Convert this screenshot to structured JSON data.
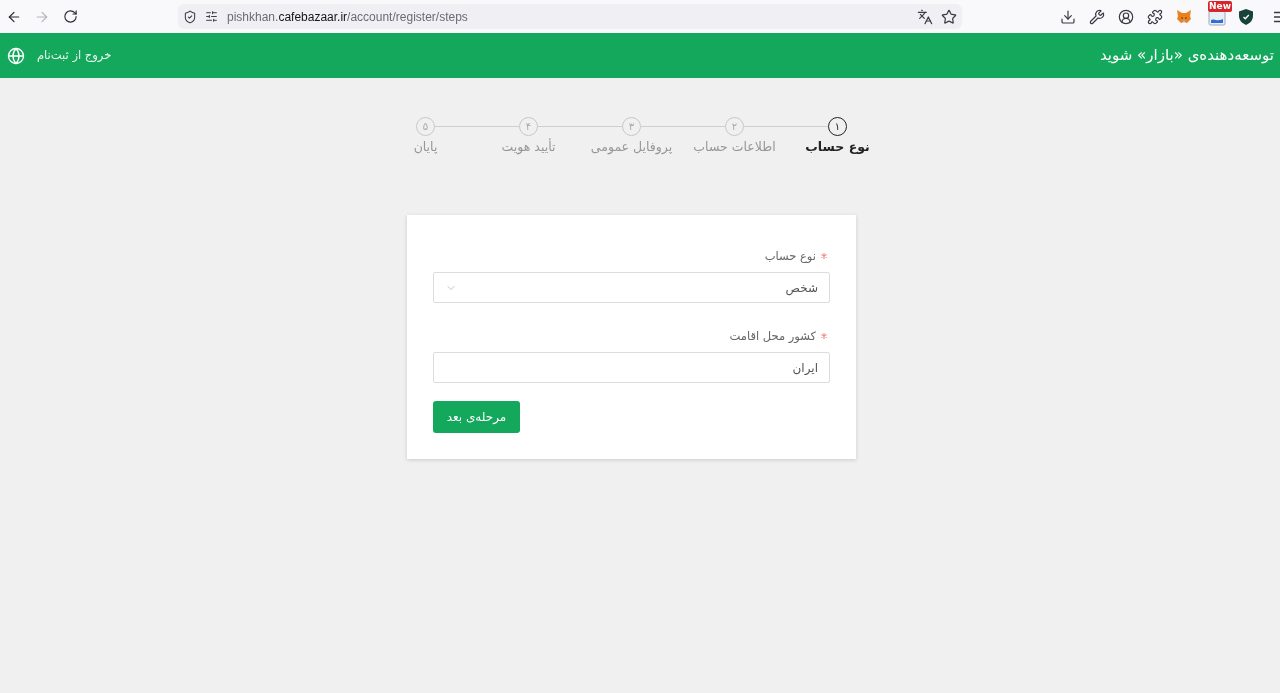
{
  "browser": {
    "back": {
      "disabled": false
    },
    "forward": {
      "disabled": true
    },
    "url": {
      "subdomain": "pishkhan.",
      "domain": "cafebazaar.ir",
      "path": "/account/register/steps"
    },
    "extension_badge": "New"
  },
  "header": {
    "title": "توسعه‌دهنده‌ی «بازار» شوید",
    "exit_link": "خروج از ثبت‌نام"
  },
  "steps": [
    {
      "number": "۱",
      "label": "نوع حساب",
      "selected": true
    },
    {
      "number": "۲",
      "label": "اطلاعات حساب",
      "selected": false
    },
    {
      "number": "۳",
      "label": "پروفایل عمومی",
      "selected": false
    },
    {
      "number": "۴",
      "label": "تأیید هویت",
      "selected": false
    },
    {
      "number": "۵",
      "label": "پایان",
      "selected": false
    }
  ],
  "form": {
    "fields": [
      {
        "kind": "select",
        "label": "نوع حساب",
        "required": true,
        "value": "شخص"
      },
      {
        "kind": "text",
        "label": "کشور محل اقامت",
        "required": true,
        "value": "ایران"
      }
    ],
    "submit_button": "مرحله‌ی بعد"
  }
}
